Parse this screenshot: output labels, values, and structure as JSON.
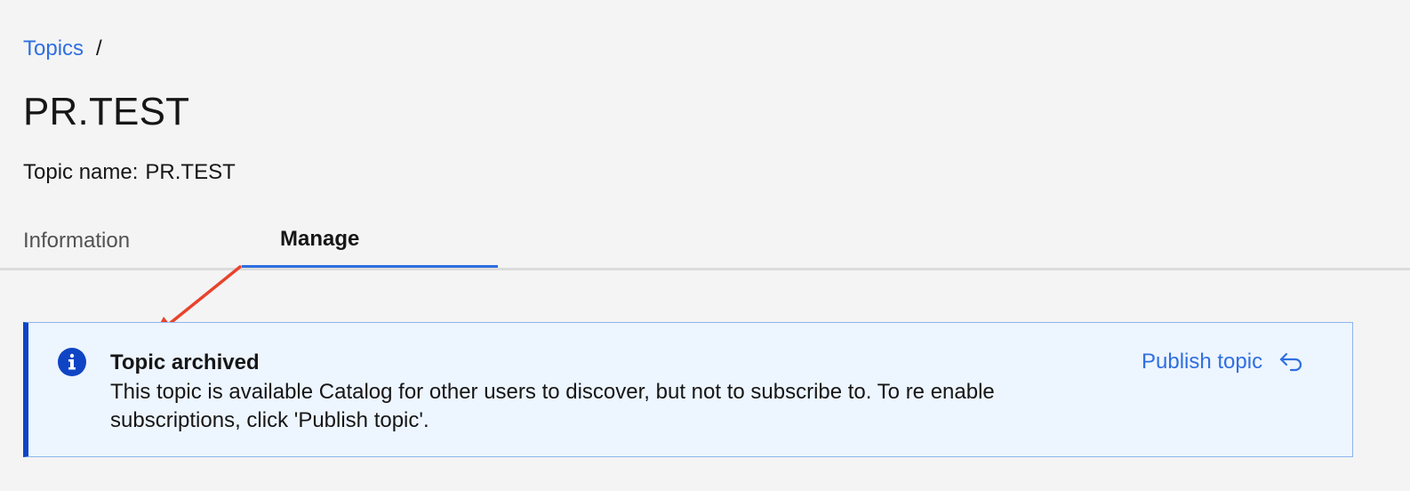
{
  "breadcrumb": {
    "link_label": "Topics",
    "separator": "/"
  },
  "page": {
    "title": "PR.TEST",
    "subtitle_label": "Topic name:",
    "subtitle_value": "PR.TEST"
  },
  "tabs": [
    {
      "label": "Information",
      "selected": false
    },
    {
      "label": "Manage",
      "selected": true
    }
  ],
  "notification": {
    "kind": "info",
    "icon": "info-icon",
    "title": "Topic archived",
    "body": "This topic is available Catalog for other users to discover, but not to subscribe to. To re enable subscriptions, click 'Publish topic'.",
    "action_label": "Publish topic",
    "action_icon": "undo-arrow-icon"
  },
  "annotation": {
    "arrow_color": "#e8432d"
  },
  "colors": {
    "accent": "#2f6fe0",
    "info_border": "#0f45c4",
    "info_background": "#edf5ff",
    "page_background": "#f4f4f4"
  }
}
